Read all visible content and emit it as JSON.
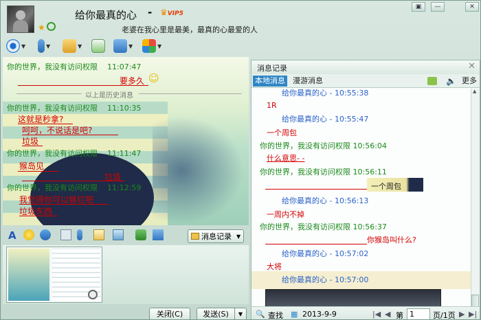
{
  "window": {
    "title": "给你最真的心",
    "title_dash": "-",
    "vip_badge": "VIP5",
    "signature": "老婆在我心里是最美，最真的心最爱的人",
    "controls": [
      "▣",
      "—",
      "✕"
    ]
  },
  "chat": {
    "history_sep": "以上是历史消息",
    "messages": [
      {
        "sender": "你的世界，我没有访问权限",
        "time": "11:07:47",
        "lines": [
          "要多久"
        ]
      },
      {
        "sender": "你的世界，我没有访问权限",
        "time": "11:10:35",
        "lines": [
          "这就是秒拿?",
          "呵呵，不说话是吧?",
          "垃圾"
        ]
      },
      {
        "sender": "你的世界，我没有访问权限",
        "time": "11:11:47",
        "lines": [
          "猴岛见",
          "垃圾"
        ]
      },
      {
        "sender": "你的世界，我没有访问权限",
        "time": "11:12:59",
        "lines": [
          "我觉得你可以够烂吧",
          "垃圾东西"
        ]
      }
    ]
  },
  "input": {
    "record_button": "消息记录",
    "close_button": "关闭(C)",
    "send_button": "发送(S)"
  },
  "history": {
    "title": "消息记录",
    "tab_local": "本地消息",
    "tab_roam": "漫游消息",
    "more": "更多",
    "entries": [
      {
        "who": "me",
        "text": "给你最真的心 - 10:55:38"
      },
      {
        "who": "msg",
        "text": "1R"
      },
      {
        "who": "me",
        "text": "给你最真的心 - 10:55:47"
      },
      {
        "who": "msg",
        "text": "一个周包"
      },
      {
        "who": "other",
        "text": "你的世界，我没有访问权限 10:56:04"
      },
      {
        "who": "msg",
        "text": "什么意思- -"
      },
      {
        "who": "other",
        "text": "你的世界，我没有访问权限 10:56:11"
      },
      {
        "who": "msg",
        "text": "一个周包"
      },
      {
        "who": "me",
        "text": "给你最真的心 - 10:56:13"
      },
      {
        "who": "msg",
        "text": "一周内不掉"
      },
      {
        "who": "other",
        "text": "你的世界，我没有访问权限 10:56:37"
      },
      {
        "who": "msg",
        "text": "你猴岛叫什么?"
      },
      {
        "who": "me",
        "text": "给你最真的心 - 10:57:02"
      },
      {
        "who": "msg",
        "text": "大将"
      },
      {
        "who": "me",
        "text": "给你最真的心 - 10:57:00"
      }
    ],
    "footer": {
      "search": "查找",
      "date": "2013-9-9",
      "page_label": "第",
      "page_value": "1",
      "page_total": "页/1页"
    }
  }
}
